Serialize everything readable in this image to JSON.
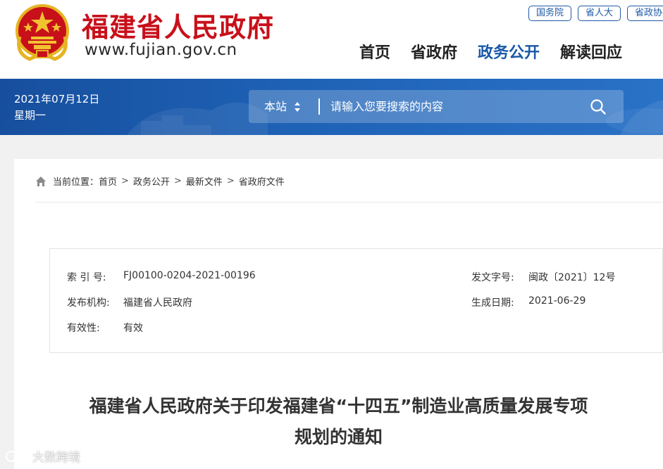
{
  "header": {
    "site_title": "福建省人民政府",
    "site_url": "www.fujian.gov.cn",
    "top_links": [
      "国务院",
      "省人大",
      "省政协"
    ],
    "nav": [
      "首页",
      "省政府",
      "政务公开",
      "解读回应"
    ],
    "active_nav": "政务公开"
  },
  "banner": {
    "date": "2021年07月12日",
    "weekday": "星期一",
    "search_scope": "本站",
    "search_placeholder": "请输入您要搜索的内容"
  },
  "breadcrumb": {
    "prefix": "当前位置：",
    "items": [
      "首页",
      "政务公开",
      "最新文件",
      "省政府文件"
    ]
  },
  "meta": {
    "index_label": "索 引 号:",
    "index_value": "FJ00100-0204-2021-00196",
    "doc_no_label": "发文字号:",
    "doc_no_value": "闽政〔2021〕12号",
    "org_label": "发布机构:",
    "org_value": "福建省人民政府",
    "date_label": "生成日期:",
    "date_value": "2021-06-29",
    "validity_label": "有效性:",
    "validity_value": "有效"
  },
  "document": {
    "title_line1": "福建省人民政府关于印发福建省“十四五”制造业高质量发展专项",
    "title_line2": "规划的通知"
  },
  "watermark": "大数跨境",
  "colors": {
    "brand_red": "#c8101a",
    "brand_blue": "#1a58a8",
    "banner_blue": "#1e62b6"
  }
}
